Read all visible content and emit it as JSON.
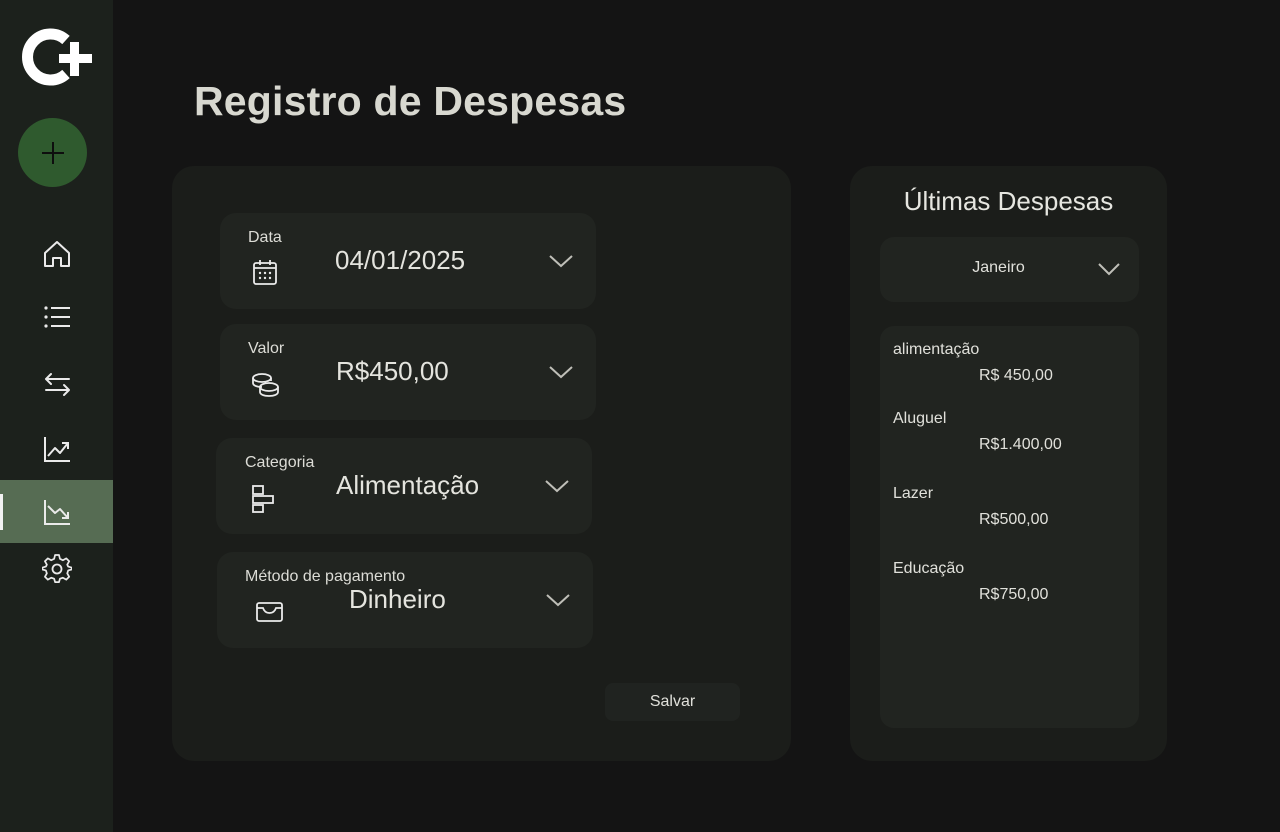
{
  "page": {
    "title": "Registro de Despesas"
  },
  "sidebar": {
    "logo": "logo-c-plus",
    "add_button_icon": "plus-icon",
    "items": [
      {
        "icon": "home-icon"
      },
      {
        "icon": "list-icon"
      },
      {
        "icon": "transfer-icon"
      },
      {
        "icon": "chart-up-icon"
      },
      {
        "icon": "chart-down-icon",
        "active": true
      },
      {
        "icon": "gear-icon"
      }
    ]
  },
  "form": {
    "date": {
      "label": "Data",
      "value": "04/01/2025",
      "icon": "calendar-icon"
    },
    "amount": {
      "label": "Valor",
      "value": "R$450,00",
      "icon": "coins-icon"
    },
    "category": {
      "label": "Categoria",
      "value": "Alimentação",
      "icon": "category-icon"
    },
    "payment": {
      "label": "Método de pagamento",
      "value": "Dinheiro",
      "icon": "wallet-icon"
    },
    "save_label": "Salvar"
  },
  "recent": {
    "title": "Últimas Despesas",
    "month": "Janeiro",
    "items": [
      {
        "category": "alimentação",
        "value": "R$ 450,00"
      },
      {
        "category": "Aluguel",
        "value": "R$1.400,00"
      },
      {
        "category": "Lazer",
        "value": "R$500,00"
      },
      {
        "category": "Educação",
        "value": "R$750,00"
      }
    ]
  },
  "colors": {
    "background": "#141414",
    "sidebar": "#1c211c",
    "accent_green": "#2f5a2e",
    "active_nav": "#566c53",
    "card": "#1b1d1a",
    "field": "#212420"
  }
}
